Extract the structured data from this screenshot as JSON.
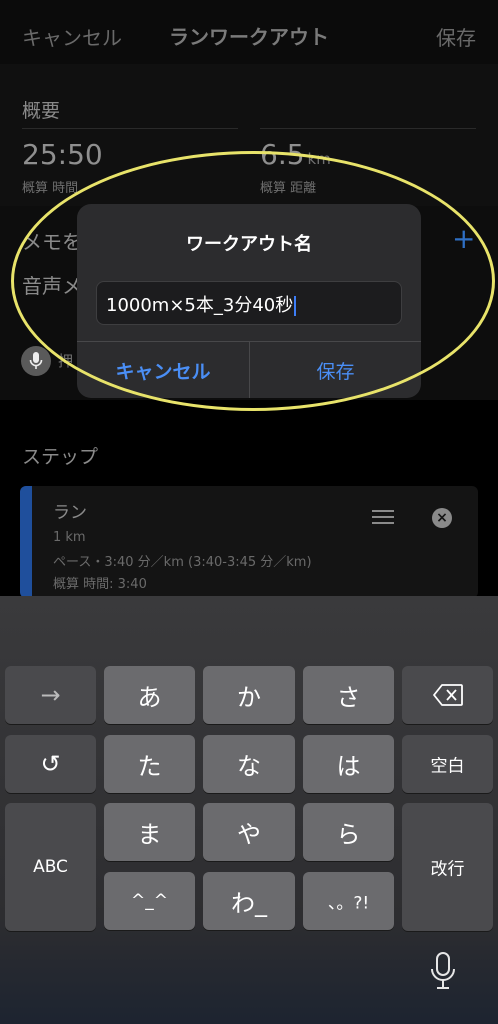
{
  "nav": {
    "cancel": "キャンセル",
    "title": "ランワークアウト",
    "save": "保存"
  },
  "summary": {
    "heading": "概要",
    "time": "25:50",
    "time_label": "概算 時間",
    "distance": "6.5",
    "distance_unit": "km",
    "distance_label": "概算 距離"
  },
  "memo": {
    "label": "メモを",
    "voice_label": "音声メ",
    "voice_text": "押"
  },
  "steps": {
    "title": "ステップ",
    "items": [
      {
        "name": "ラン",
        "distance": "1 km",
        "pace": "ペース・3:40 分／km (3:40-3:45 分／km)",
        "time": "概算 時間: 3:40"
      }
    ]
  },
  "dialog": {
    "title": "ワークアウト名",
    "input_value": "1000m×5本_3分40秒",
    "cancel": "キャンセル",
    "save": "保存"
  },
  "keyboard": {
    "arrow": "→",
    "undo": "↺",
    "abc": "ABC",
    "a": "あ",
    "ka": "か",
    "sa": "さ",
    "ta": "た",
    "na": "な",
    "ha": "は",
    "ma": "ま",
    "ya": "や",
    "ra": "ら",
    "kaomoji": "^_^",
    "wa": "わ_",
    "punct": "、。?!",
    "space": "空白",
    "enter": "改行"
  },
  "colors": {
    "accent": "#4a8ef5",
    "highlight": "#e8e36a",
    "step_bar": "#1f4f9c"
  }
}
